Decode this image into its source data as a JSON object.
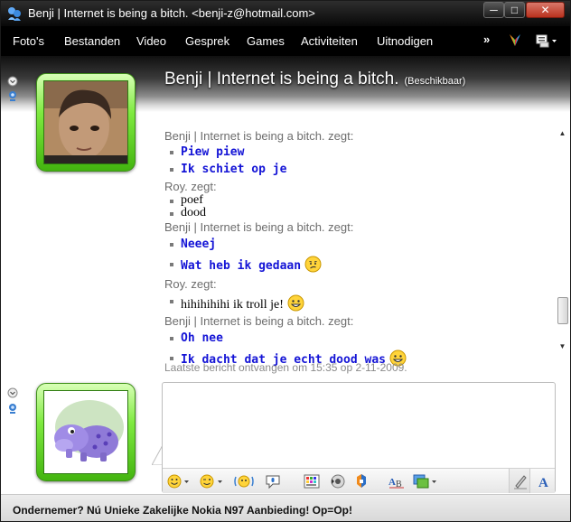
{
  "window": {
    "title": "Benji | Internet is being a bitch. <benji-z@hotmail.com>",
    "minimize_label": "─",
    "maximize_label": "□",
    "close_label": "✕"
  },
  "menu": {
    "items": [
      "Foto's",
      "Bestanden",
      "Video",
      "Gesprek",
      "Games",
      "Activiteiten",
      "Uitnodigen"
    ],
    "more_label": "»"
  },
  "contact": {
    "name": "Benji | Internet is being a bitch.",
    "status": "(Beschikbaar)"
  },
  "conversation": {
    "messages": [
      {
        "sender": "Benji | Internet is being a bitch. zegt:",
        "lines": [
          "Piew piew",
          "Ik schiet op je"
        ]
      },
      {
        "sender": "Roy. zegt:",
        "lines": [
          "poef",
          "dood"
        ]
      },
      {
        "sender": "Benji | Internet is being a bitch. zegt:",
        "lines": [
          "Neeej",
          "Wat heb ik gedaan"
        ]
      },
      {
        "sender": "Roy. zegt:",
        "lines": [
          "hihihihihi ik troll je!"
        ]
      },
      {
        "sender": "Benji | Internet is being a bitch. zegt:",
        "lines": [
          "Oh nee",
          "Ik dacht dat je echt dood was"
        ]
      }
    ],
    "last_message": "Laatste bericht ontvangen om 15:35 op 2-11-2009."
  },
  "input": {
    "placeholder": ""
  },
  "toolbar": {
    "icons": [
      "emoticon-icon",
      "wink-icon",
      "nudge-icon",
      "voice-clip-icon",
      "background-icon",
      "sound-icon",
      "game-icon",
      "translate-icon",
      "photo-share-icon",
      "handwriting-icon",
      "font-icon"
    ]
  },
  "footer": {
    "ad": "Ondernemer? Nú Unieke Zakelijke Nokia N97 Aanbieding! Op=Op!"
  },
  "colors": {
    "titlebar": "#0a0a0a",
    "menubar": "#000000",
    "frame_green": "#6fdc3a",
    "message_blue": "#1414d6",
    "sender_gray": "#6d6d6d"
  }
}
